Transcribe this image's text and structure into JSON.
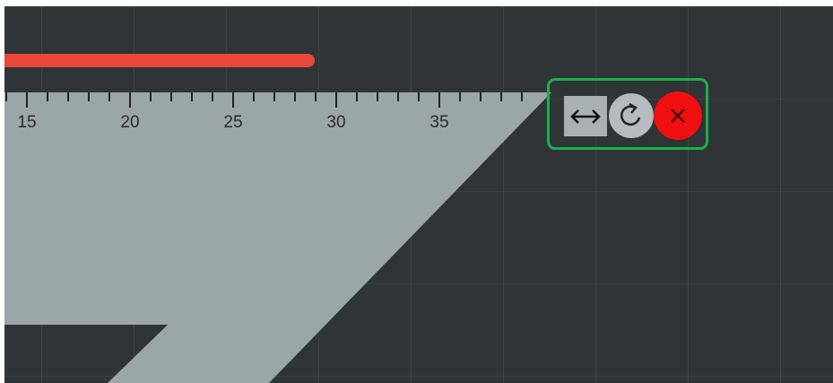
{
  "ruler": {
    "tick_labels": [
      "15",
      "20",
      "25",
      "30",
      "35"
    ]
  },
  "tool_controls": {
    "flip_icon": "double-arrow-horizontal-icon",
    "rotate_icon": "rotate-clockwise-icon",
    "close_icon": "close-x-icon"
  },
  "colors": {
    "canvas_background": "#2f3537",
    "set_square": "#9aa6a7",
    "drawn_line": "#e9483b",
    "controls_highlight": "#1fae4b",
    "close_button": "#f01010"
  }
}
